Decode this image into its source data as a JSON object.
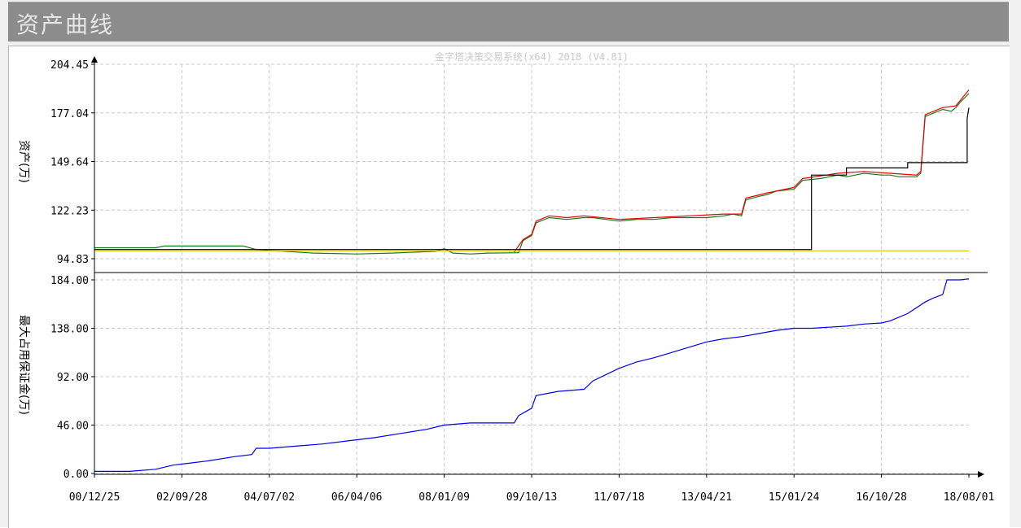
{
  "window": {
    "title": "资产曲线",
    "watermark": "金字塔决策交易系统(x64) 2018 (V4.81)"
  },
  "chart_data": [
    {
      "type": "line",
      "ylabel": "资产(万)",
      "y_ticks": [
        "204.45",
        "177.04",
        "149.64",
        "122.23",
        "94.83"
      ],
      "ylim": [
        94.83,
        204.45
      ],
      "x_ticks": [
        "00/12/25",
        "02/09/28",
        "04/07/02",
        "06/04/06",
        "08/01/09",
        "09/10/13",
        "11/07/18",
        "13/04/21",
        "15/01/24",
        "16/10/28",
        "18/08/01"
      ],
      "grid": true,
      "series": [
        {
          "color": "#1a7a1a",
          "points": [
            [
              0,
              101
            ],
            [
              0.07,
              101
            ],
            [
              0.08,
              102
            ],
            [
              0.17,
              102
            ],
            [
              0.185,
              100
            ],
            [
              0.25,
              98
            ],
            [
              0.3,
              97.5
            ],
            [
              0.34,
              98
            ],
            [
              0.39,
              99
            ],
            [
              0.4,
              100.5
            ],
            [
              0.41,
              98
            ],
            [
              0.43,
              97.5
            ],
            [
              0.45,
              98
            ],
            [
              0.485,
              98.2
            ],
            [
              0.49,
              105
            ],
            [
              0.5,
              108
            ],
            [
              0.505,
              115
            ],
            [
              0.52,
              118
            ],
            [
              0.54,
              117
            ],
            [
              0.56,
              118
            ],
            [
              0.57,
              118
            ],
            [
              0.6,
              116
            ],
            [
              0.62,
              117
            ],
            [
              0.64,
              117
            ],
            [
              0.66,
              118
            ],
            [
              0.68,
              118
            ],
            [
              0.7,
              118
            ],
            [
              0.72,
              119
            ],
            [
              0.73,
              120
            ],
            [
              0.74,
              119
            ],
            [
              0.745,
              128
            ],
            [
              0.76,
              130
            ],
            [
              0.77,
              131
            ],
            [
              0.78,
              133
            ],
            [
              0.8,
              134
            ],
            [
              0.81,
              139
            ],
            [
              0.83,
              140
            ],
            [
              0.85,
              142
            ],
            [
              0.86,
              141
            ],
            [
              0.87,
              142
            ],
            [
              0.88,
              143
            ],
            [
              0.9,
              142
            ],
            [
              0.91,
              142
            ],
            [
              0.92,
              141
            ],
            [
              0.94,
              141
            ],
            [
              0.945,
              143
            ],
            [
              0.95,
              175
            ],
            [
              0.96,
              177
            ],
            [
              0.97,
              179
            ],
            [
              0.98,
              178
            ],
            [
              0.985,
              180
            ],
            [
              0.99,
              183
            ],
            [
              1.0,
              188
            ]
          ]
        },
        {
          "color": "#e60000",
          "points": [
            [
              0.48,
              98.5
            ],
            [
              0.49,
              105.5
            ],
            [
              0.5,
              108.5
            ],
            [
              0.505,
              116
            ],
            [
              0.52,
              119
            ],
            [
              0.54,
              118
            ],
            [
              0.56,
              119
            ],
            [
              0.6,
              117
            ],
            [
              0.64,
              118
            ],
            [
              0.68,
              119
            ],
            [
              0.72,
              120
            ],
            [
              0.74,
              120
            ],
            [
              0.745,
              129
            ],
            [
              0.77,
              132
            ],
            [
              0.8,
              135
            ],
            [
              0.81,
              140
            ],
            [
              0.85,
              143
            ],
            [
              0.88,
              144
            ],
            [
              0.91,
              143
            ],
            [
              0.94,
              142
            ],
            [
              0.945,
              144
            ],
            [
              0.95,
              176
            ],
            [
              0.97,
              180
            ],
            [
              0.985,
              181
            ],
            [
              0.99,
              184
            ],
            [
              1.0,
              190
            ]
          ]
        },
        {
          "color": "#000000",
          "points": [
            [
              0,
              100
            ],
            [
              0.82,
              100
            ],
            [
              0.82,
              142
            ],
            [
              0.86,
              142
            ],
            [
              0.86,
              146
            ],
            [
              0.93,
              146
            ],
            [
              0.93,
              149
            ],
            [
              0.998,
              149
            ],
            [
              0.998,
              174
            ],
            [
              1.0,
              180
            ]
          ]
        },
        {
          "color": "#d4c200",
          "points": [
            [
              0,
              99.3
            ],
            [
              1.0,
              99.3
            ]
          ]
        }
      ]
    },
    {
      "type": "line",
      "ylabel": "最大占用保证金(万)",
      "y_ticks": [
        "184.00",
        "138.00",
        "92.00",
        "46.00",
        "0.00"
      ],
      "ylim": [
        0,
        184
      ],
      "x_ticks": [
        "00/12/25",
        "02/09/28",
        "04/07/02",
        "06/04/06",
        "08/01/09",
        "09/10/13",
        "11/07/18",
        "13/04/21",
        "15/01/24",
        "16/10/28",
        "18/08/01"
      ],
      "grid": true,
      "series": [
        {
          "color": "#0000e6",
          "points": [
            [
              0,
              2
            ],
            [
              0.04,
              2
            ],
            [
              0.07,
              4
            ],
            [
              0.09,
              8
            ],
            [
              0.11,
              10
            ],
            [
              0.13,
              12
            ],
            [
              0.16,
              16
            ],
            [
              0.18,
              18
            ],
            [
              0.185,
              24
            ],
            [
              0.2,
              24
            ],
            [
              0.23,
              26
            ],
            [
              0.26,
              28
            ],
            [
              0.29,
              31
            ],
            [
              0.32,
              34
            ],
            [
              0.35,
              38
            ],
            [
              0.38,
              42
            ],
            [
              0.4,
              46
            ],
            [
              0.43,
              48
            ],
            [
              0.48,
              48
            ],
            [
              0.485,
              55
            ],
            [
              0.5,
              62
            ],
            [
              0.505,
              74
            ],
            [
              0.53,
              78
            ],
            [
              0.56,
              80
            ],
            [
              0.57,
              88
            ],
            [
              0.6,
              100
            ],
            [
              0.62,
              106
            ],
            [
              0.64,
              110
            ],
            [
              0.66,
              115
            ],
            [
              0.68,
              120
            ],
            [
              0.7,
              125
            ],
            [
              0.72,
              128
            ],
            [
              0.74,
              130
            ],
            [
              0.76,
              133
            ],
            [
              0.78,
              136
            ],
            [
              0.8,
              138
            ],
            [
              0.82,
              138
            ],
            [
              0.84,
              139
            ],
            [
              0.86,
              140
            ],
            [
              0.88,
              142
            ],
            [
              0.9,
              143
            ],
            [
              0.91,
              145
            ],
            [
              0.93,
              152
            ],
            [
              0.95,
              163
            ],
            [
              0.96,
              167
            ],
            [
              0.97,
              170
            ],
            [
              0.975,
              184
            ],
            [
              0.99,
              184
            ],
            [
              1.0,
              185
            ]
          ]
        }
      ]
    }
  ]
}
